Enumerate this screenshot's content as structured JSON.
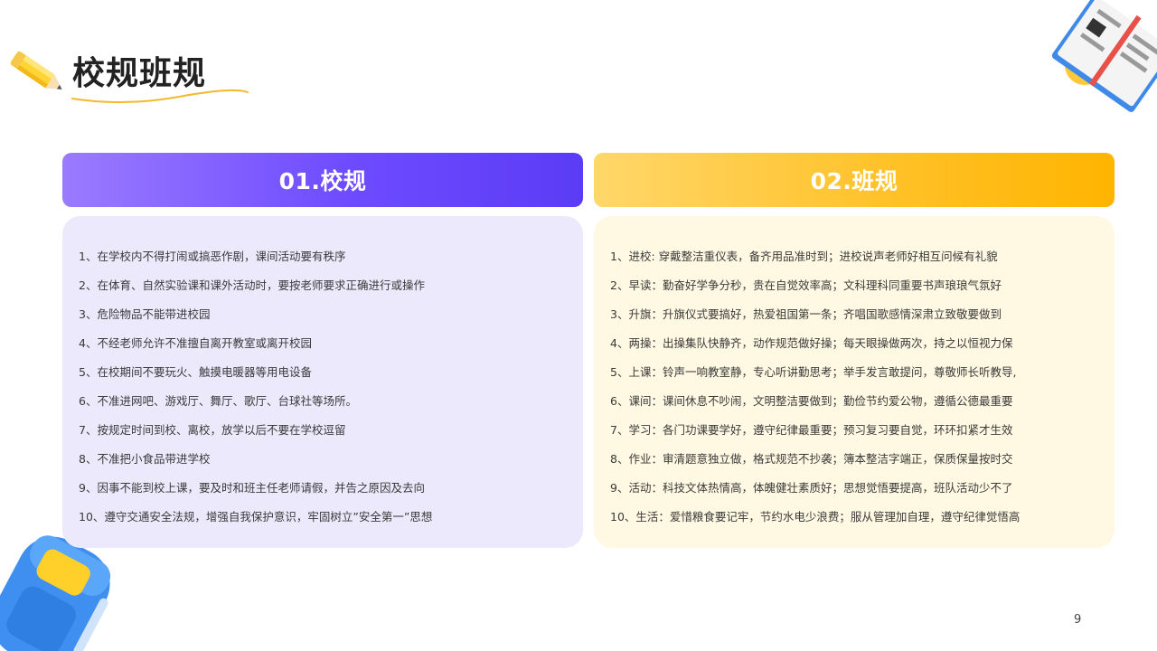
{
  "slide": {
    "title": "校规班规",
    "page_number": "9"
  },
  "columns": [
    {
      "header": "01.校规",
      "color": "#6e4bff",
      "items": [
        "1、在学校内不得打闹或搞恶作剧，课间活动要有秩序",
        "2、在体育、自然实验课和课外活动时，要按老师要求正确进行或操作",
        "3、危险物品不能带进校园",
        "4、不经老师允许不准擅自离开教室或离开校园",
        "5、在校期间不要玩火、触摸电暖器等用电设备",
        "6、不准进网吧、游戏厅、舞厅、歌厅、台球社等场所。",
        "7、按规定时间到校、离校，放学以后不要在学校逗留",
        "8、不准把小食品带进学校",
        "9、因事不能到校上课，要及时和班主任老师请假，并告之原因及去向",
        "10、遵守交通安全法规，增强自我保护意识，牢固树立”安全第一”思想"
      ]
    },
    {
      "header": "02.班规",
      "color": "#ffb400",
      "items": [
        "1、进校: 穿戴整洁重仪表，备齐用品准时到；进校说声老师好相互问候有礼貌",
        "2、早读：勤奋好学争分秒，贵在自觉效率高；文科理科同重要书声琅琅气氛好",
        "3、升旗：升旗仪式要搞好，热爱祖国第一条；齐唱国歌感情深肃立致敬要做到",
        "4、两操：出操集队快静齐，动作规范做好操；每天眼操做两次，持之以恒视力保",
        "5、上课：铃声一响教室静，专心听讲勤思考；举手发言敢提问，尊敬师长听教导,",
        "6、课间：课间休息不吵闹，文明整洁要做到；勤俭节约爱公物，遵循公德最重要",
        "7、学习：各门功课要学好，遵守纪律最重要；预习复习要自觉，环环扣紧才生效",
        "8、作业：审清题意独立做，格式规范不抄袭；簿本整洁字端正，保质保量按时交",
        "9、活动：科技文体热情高，体魄健壮素质好；思想觉悟要提高，班队活动少不了",
        "10、生活：爱惜粮食要记牢，节约水电少浪费；服从管理加自理，遵守纪律觉悟高"
      ]
    }
  ],
  "decorations": {
    "pencil": "pencil-icon",
    "book": "open-book-icon",
    "backpack": "backpack-icon",
    "accent_colors": [
      "#ffc400",
      "#4a9ef5"
    ]
  }
}
